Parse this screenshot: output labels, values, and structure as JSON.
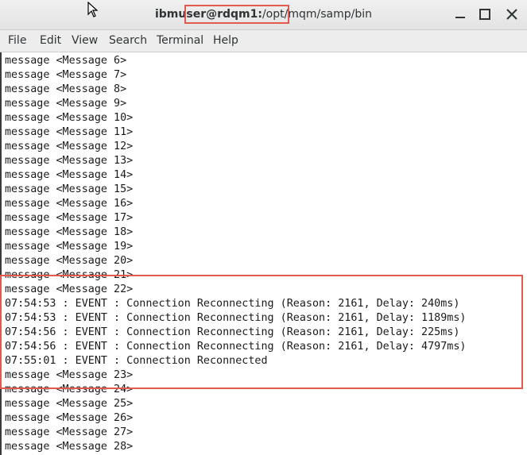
{
  "window": {
    "title_user": "ibmuser@rdqm1:",
    "title_path": "/opt/mqm/samp/bin"
  },
  "menu": [
    "File",
    "Edit",
    "View",
    "Search",
    "Terminal",
    "Help"
  ],
  "terminal_lines": [
    "message <Message 6>",
    "message <Message 7>",
    "message <Message 8>",
    "message <Message 9>",
    "message <Message 10>",
    "message <Message 11>",
    "message <Message 12>",
    "message <Message 13>",
    "message <Message 14>",
    "message <Message 15>",
    "message <Message 16>",
    "message <Message 17>",
    "message <Message 18>",
    "message <Message 19>",
    "message <Message 20>",
    "message <Message 21>",
    "message <Message 22>",
    "07:54:53 : EVENT : Connection Reconnecting (Reason: 2161, Delay: 240ms)",
    "07:54:53 : EVENT : Connection Reconnecting (Reason: 2161, Delay: 1189ms)",
    "07:54:56 : EVENT : Connection Reconnecting (Reason: 2161, Delay: 225ms)",
    "07:54:56 : EVENT : Connection Reconnecting (Reason: 2161, Delay: 4797ms)",
    "07:55:01 : EVENT : Connection Reconnected",
    "message <Message 23>",
    "message <Message 24>",
    "message <Message 25>",
    "message <Message 26>",
    "message <Message 27>",
    "message <Message 28>"
  ],
  "colors": {
    "highlight": "#e05a4f"
  }
}
